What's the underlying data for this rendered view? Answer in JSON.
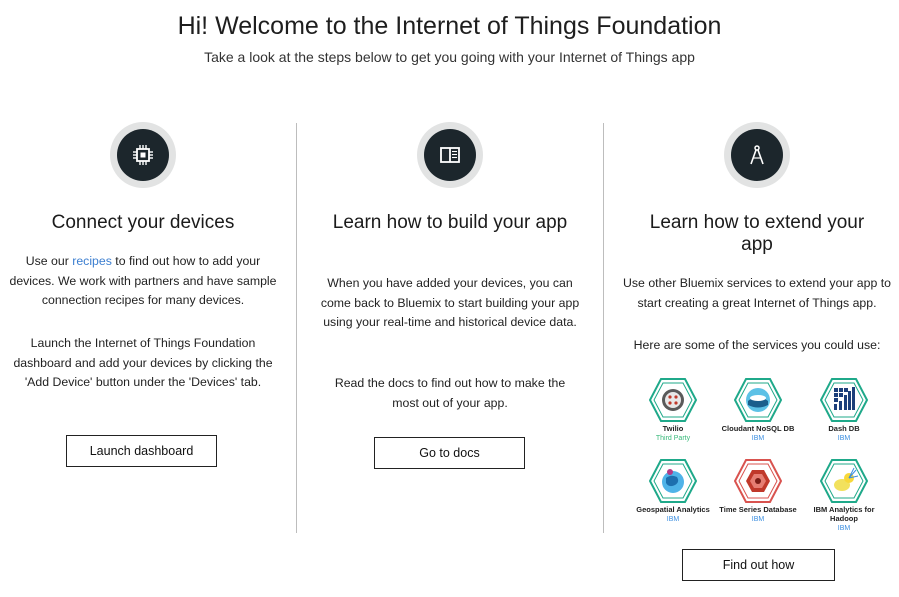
{
  "header": {
    "title": "Hi! Welcome to the Internet of Things Foundation",
    "subtitle": "Take a look at the steps below to get you going with your Internet of Things app"
  },
  "columns": [
    {
      "icon": "chip-icon",
      "heading": "Connect your devices",
      "para1_pre": "Use our ",
      "para1_link": "recipes",
      "para1_post": " to find out how to add your devices. We work with partners and have sample connection recipes for many devices.",
      "para2": "Launch the Internet of Things Foundation dashboard and add your devices by clicking the 'Add Device' button under the 'Devices' tab.",
      "button": "Launch dashboard"
    },
    {
      "icon": "book-icon",
      "heading": "Learn how to build your app",
      "para1": "When you have added your devices, you can come back to Bluemix to start building your app using your real-time and historical device data.",
      "para2": "Read the docs to find out how to make the most out of your app.",
      "button": "Go to docs"
    },
    {
      "icon": "compass-icon",
      "heading": "Learn how to extend your app",
      "para1": "Use other Bluemix services to extend your app to start creating a great Internet of Things app.",
      "para2": "Here are some of the services you could use:",
      "button": "Find out how"
    }
  ],
  "services": [
    {
      "name": "Twilio",
      "provider": "Third Party",
      "icon": "twilio-icon",
      "color": "#1fa98a"
    },
    {
      "name": "Cloudant NoSQL DB",
      "provider": "IBM",
      "icon": "cloudant-icon",
      "color": "#1fa98a"
    },
    {
      "name": "Dash DB",
      "provider": "IBM",
      "icon": "dashdb-icon",
      "color": "#1fa98a"
    },
    {
      "name": "Geospatial Analytics",
      "provider": "IBM",
      "icon": "geospatial-icon",
      "color": "#1fa98a"
    },
    {
      "name": "Time Series Database",
      "provider": "IBM",
      "icon": "timeseries-icon",
      "color": "#d9534f"
    },
    {
      "name": "IBM Analytics for Hadoop",
      "provider": "IBM",
      "icon": "hadoop-icon",
      "color": "#1fa98a"
    }
  ],
  "colors": {
    "link": "#3b7ed0",
    "icon_core": "#1c262c",
    "provider_ibm": "#3b8ee0",
    "provider_third_party": "#38b97a"
  }
}
